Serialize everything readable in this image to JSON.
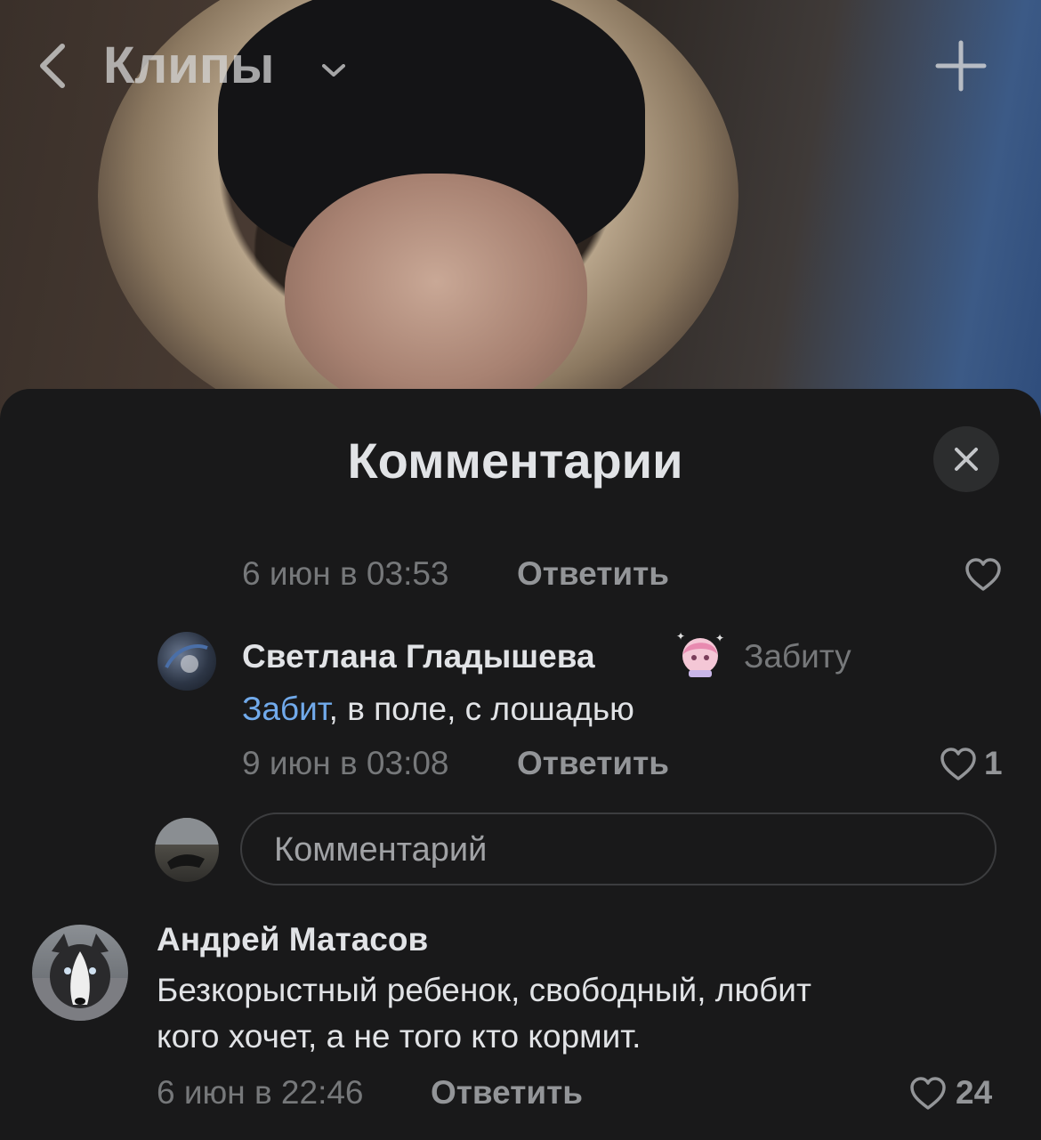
{
  "header": {
    "title": "Клипы"
  },
  "sheet": {
    "title": "Комментарии"
  },
  "comments": [
    {
      "date": "6 июн в 03:53",
      "reply_label": "Ответить"
    },
    {
      "author": "Светлана Гладышева",
      "reply_to": "Забиту",
      "mention": "Забит",
      "text": ", в поле, с лошадью",
      "date": "9 июн в 03:08",
      "reply_label": "Ответить",
      "likes": "1"
    },
    {
      "author": "Андрей Матасов",
      "text_line1": "Безкорыстный ребенок, свободный, любит",
      "text_line2": "кого хочет, а не того кто кормит.",
      "date": "6 июн в 22:46",
      "reply_label": "Ответить",
      "likes": "24"
    }
  ],
  "input": {
    "placeholder": "Комментарий"
  },
  "colors": {
    "background": "#19191a",
    "text": "#e1e3e6",
    "secondary": "#76787a",
    "link": "#71aaeb"
  }
}
